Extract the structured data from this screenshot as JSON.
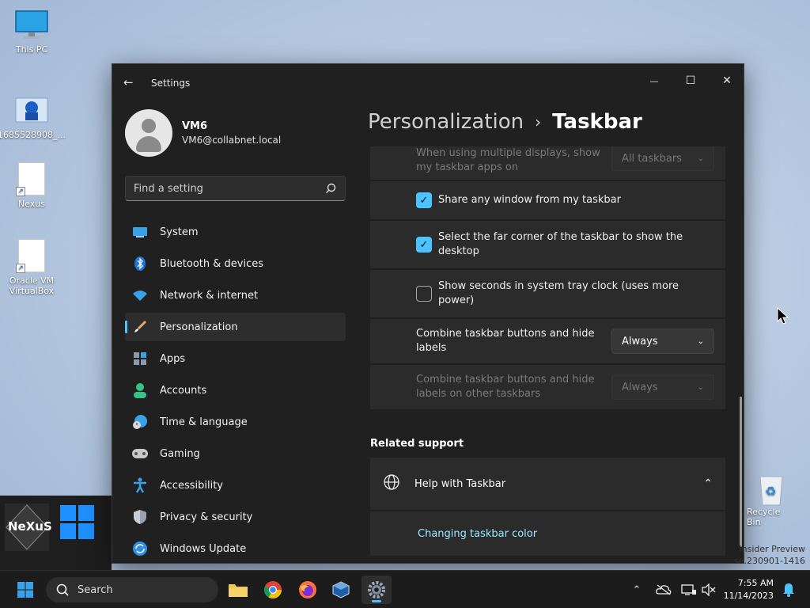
{
  "desktop": {
    "icons": [
      {
        "label": "This PC"
      },
      {
        "label": "1685528908_..."
      },
      {
        "label": "Nexus"
      },
      {
        "label": "Oracle VM VirtualBox"
      }
    ],
    "recycle_bin": "Recycle Bin",
    "watermark_line1": "Insider Preview",
    "watermark_line2": "se.230901-1416"
  },
  "window": {
    "title": "Settings",
    "back_glyph": "←",
    "minimize_glyph": "—",
    "maximize_glyph": "☐",
    "close_glyph": "✕"
  },
  "profile": {
    "name": "VM6",
    "email": "VM6@collabnet.local"
  },
  "search": {
    "placeholder": "Find a setting"
  },
  "nav": {
    "items": [
      {
        "label": "System"
      },
      {
        "label": "Bluetooth & devices"
      },
      {
        "label": "Network & internet"
      },
      {
        "label": "Personalization"
      },
      {
        "label": "Apps"
      },
      {
        "label": "Accounts"
      },
      {
        "label": "Time & language"
      },
      {
        "label": "Gaming"
      },
      {
        "label": "Accessibility"
      },
      {
        "label": "Privacy & security"
      },
      {
        "label": "Windows Update"
      }
    ],
    "active_index": 3
  },
  "breadcrumb": {
    "parent": "Personalization",
    "separator": "›",
    "current": "Taskbar"
  },
  "settings": {
    "multi_display_label": "When using multiple displays, show my taskbar apps on",
    "multi_display_value": "All taskbars",
    "share_window_label": "Share any window from my taskbar",
    "share_window_checked": true,
    "far_corner_label": "Select the far corner of the taskbar to show the desktop",
    "far_corner_checked": true,
    "show_seconds_label": "Show seconds in system tray clock (uses more power)",
    "show_seconds_checked": false,
    "combine_label": "Combine taskbar buttons and hide labels",
    "combine_value": "Always",
    "combine_other_label": "Combine taskbar buttons and hide labels on other taskbars",
    "combine_other_value": "Always",
    "check_glyph": "✓",
    "chevron_glyph": "⌄"
  },
  "related": {
    "title": "Related support",
    "help_label": "Help with Taskbar",
    "help_link": "Changing taskbar color",
    "collapse_glyph": "⌃"
  },
  "taskbar": {
    "search_label": "Search",
    "time": "7:55 AM",
    "date": "11/14/2023",
    "tray_chevron": "⌃"
  },
  "colors": {
    "accent": "#4cc2ff",
    "link": "#99ebff",
    "window_bg": "#202020",
    "card_bg": "#2b2b2b"
  }
}
